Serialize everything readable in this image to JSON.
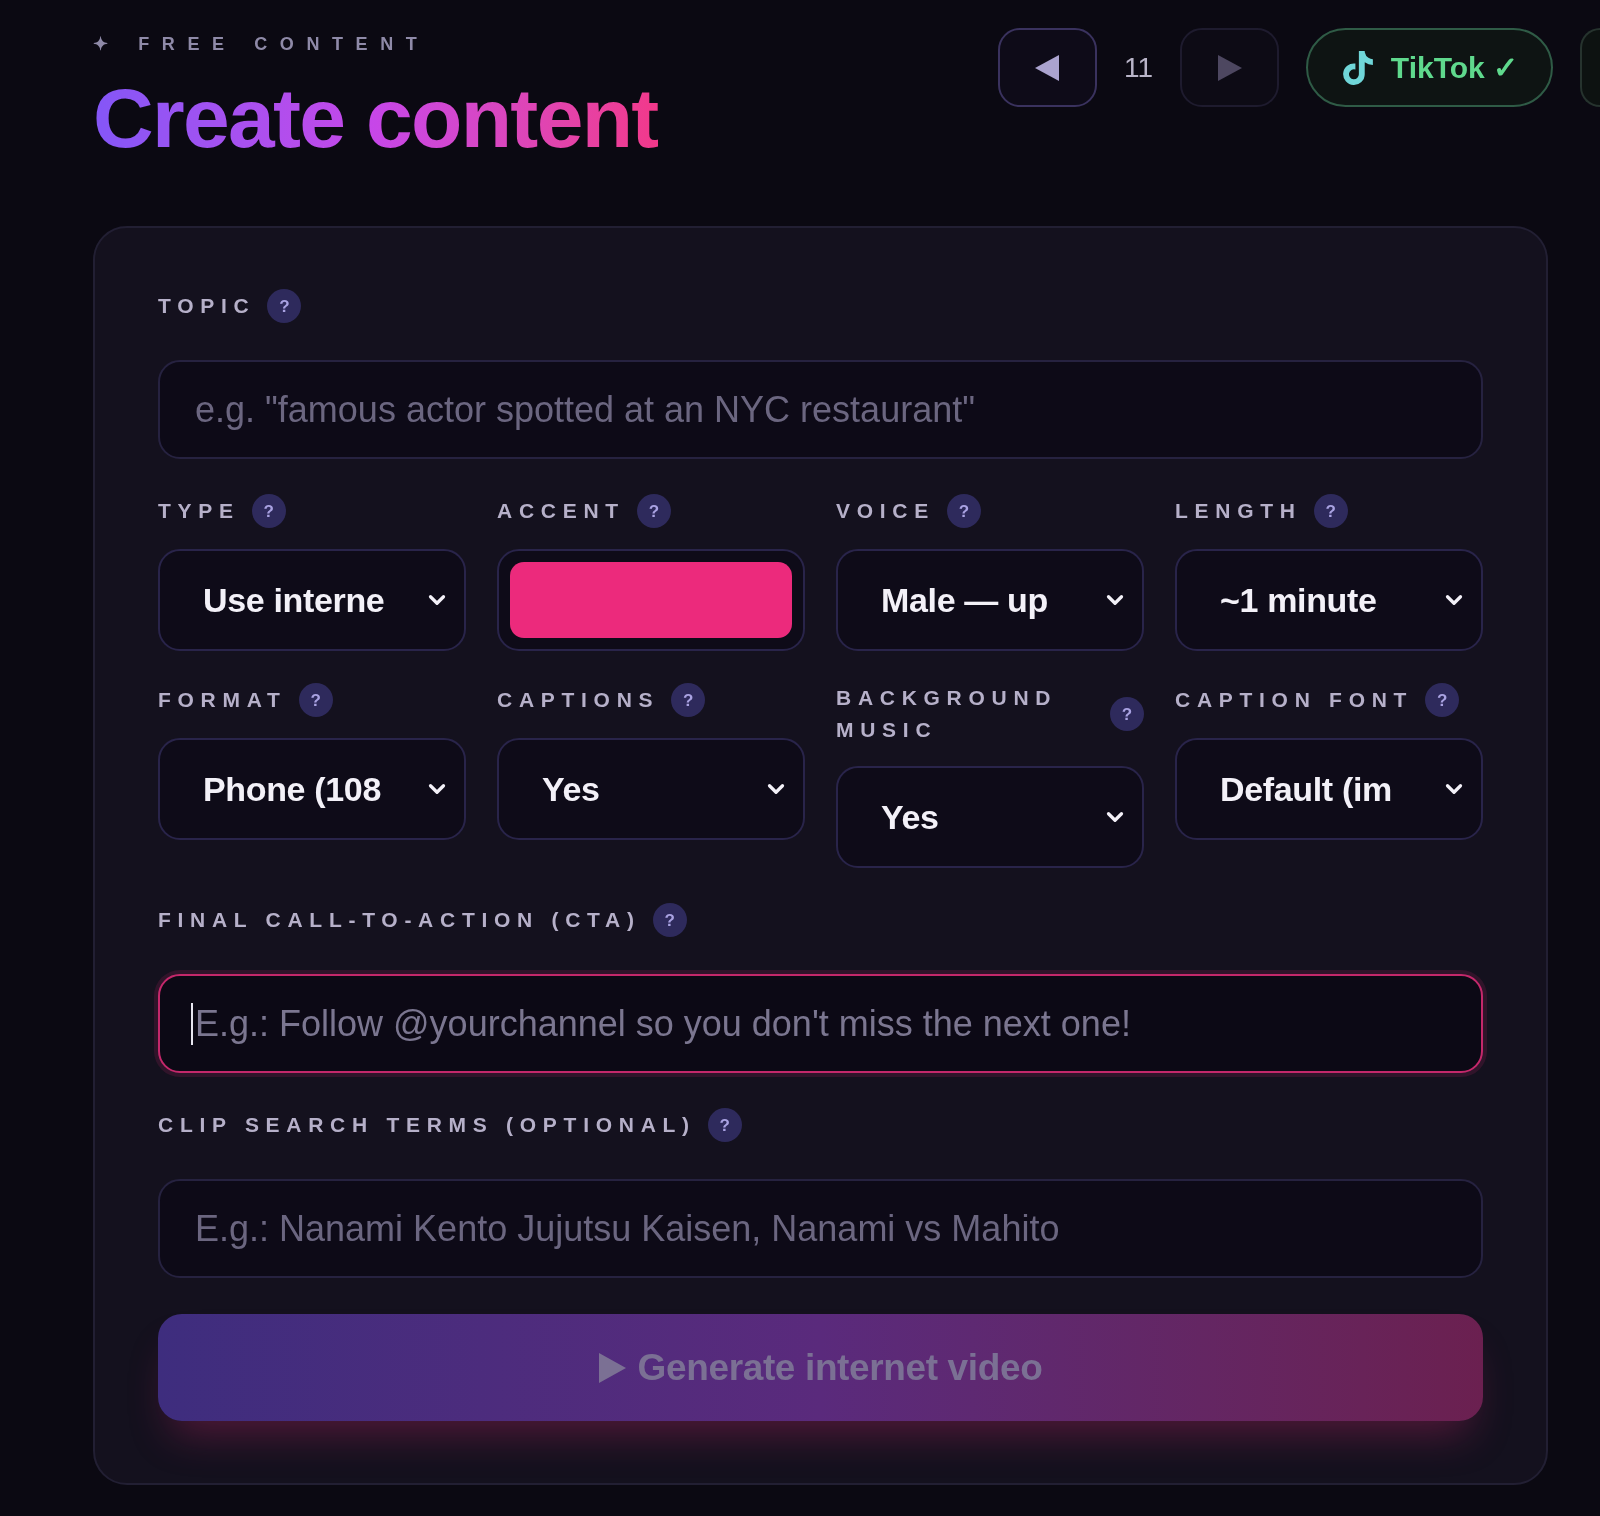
{
  "header": {
    "eyebrow": "✦ FREE CONTENT",
    "title": "Create content"
  },
  "pager": {
    "prev": {
      "disabled": false
    },
    "page": "11",
    "next": {
      "disabled": true
    }
  },
  "platforms": [
    {
      "label": "TikTok",
      "mark": "✓",
      "connected": true,
      "cut_off": false
    },
    {
      "cut_off": true
    }
  ],
  "form": {
    "topic": {
      "label": "TOPIC",
      "help": "?",
      "placeholder": "e.g. \"famous actor spotted at an NYC restaurant\"",
      "focused": false
    },
    "options": [
      {
        "kind": "select",
        "label": "TYPE",
        "help": "?",
        "value": "Use interne"
      },
      {
        "kind": "color",
        "label": "ACCENT",
        "help": "?",
        "color": "#ec2a7c"
      },
      {
        "kind": "select",
        "label": "VOICE",
        "help": "?",
        "value": "Male — up"
      },
      {
        "kind": "select",
        "label": "LENGTH",
        "help": "?",
        "value": "~1 minute"
      },
      {
        "kind": "select",
        "label": "FORMAT",
        "help": "?",
        "value": "Phone (108"
      },
      {
        "kind": "select",
        "label": "CAPTIONS",
        "help": "?",
        "value": "Yes"
      },
      {
        "kind": "select",
        "label": "BACKGROUND MUSIC",
        "help": "?",
        "value": "Yes"
      },
      {
        "kind": "select",
        "label": "CAPTION FONT",
        "help": "?",
        "value": "Default (im"
      }
    ],
    "cta": {
      "label": "FINAL CALL-TO-ACTION (CTA)",
      "help": "?",
      "placeholder": "E.g.: Follow @yourchannel so you don't miss the next one!",
      "focused": true
    },
    "clip_terms": {
      "label": "CLIP SEARCH TERMS (OPTIONAL)",
      "help": "?",
      "placeholder": "E.g.: Nanami Kento Jujutsu Kaisen, Nanami vs Mahito",
      "focused": false
    },
    "generate": {
      "label": "Generate internet video",
      "disabled": true
    }
  }
}
